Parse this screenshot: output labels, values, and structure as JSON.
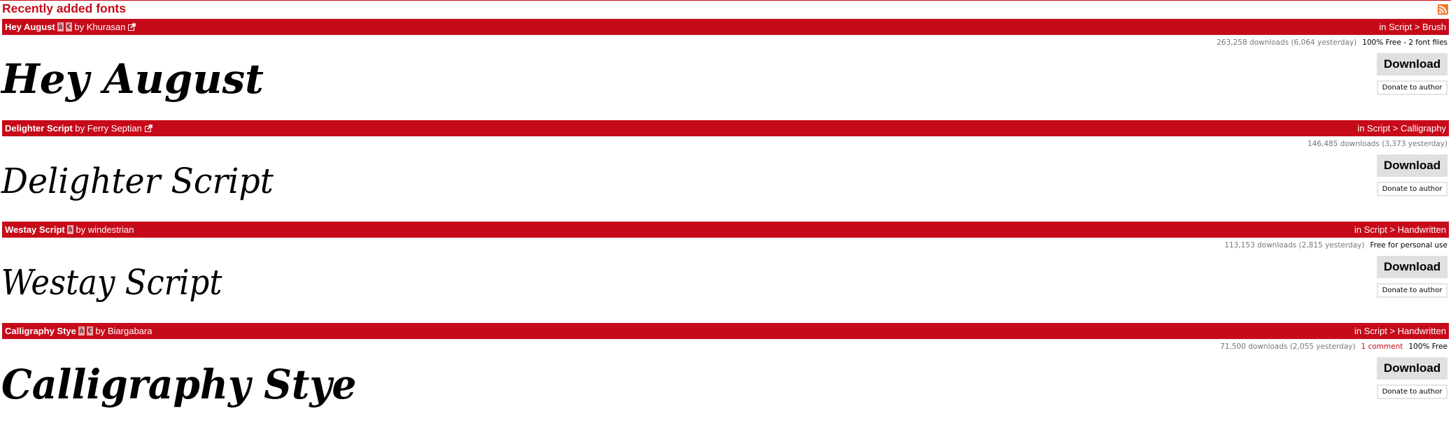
{
  "page": {
    "title": "Recently added fonts",
    "rss_icon": "rss-feed-icon"
  },
  "colors": {
    "accent": "#c70a19",
    "button_bg": "#e0e0e0",
    "muted_text": "#777777",
    "license_badge": "#f3a3a8",
    "rss": "#ee7b2b"
  },
  "fonts": [
    {
      "name": "Hey August",
      "badges": [
        "à",
        "€"
      ],
      "by": "by",
      "author": "Khurasan",
      "external_link_icon": true,
      "category": "in Script > Brush",
      "downloads": "263,258 downloads (6,064 yesterday)",
      "comments": "",
      "license": "100% Free - 2 font files",
      "preview_text": "Hey August",
      "download_label": "Download",
      "donate_label": "Donate to author"
    },
    {
      "name": "Delighter Script",
      "badges": [],
      "by": "by",
      "author": "Ferry Septian",
      "external_link_icon": true,
      "category": "in Script > Calligraphy",
      "downloads": "146,485 downloads (3,373 yesterday)",
      "comments": "",
      "license": "",
      "preview_text": "Delighter Script",
      "download_label": "Download",
      "donate_label": "Donate to author"
    },
    {
      "name": "Westay Script",
      "badges": [
        "à"
      ],
      "by": "by",
      "author": "windestrian",
      "external_link_icon": false,
      "category": "in Script > Handwritten",
      "downloads": "113,153 downloads (2,815 yesterday)",
      "comments": "",
      "license": "Free for personal use",
      "preview_text": "Westay Script",
      "download_label": "Download",
      "donate_label": "Donate to author"
    },
    {
      "name": "Calligraphy Stye",
      "badges": [
        "à",
        "€"
      ],
      "by": "by",
      "author": "Biargabara",
      "external_link_icon": false,
      "category": "in Script > Handwritten",
      "downloads": "71,500 downloads (2,055 yesterday)",
      "comments": "1 comment",
      "license": "100% Free",
      "preview_text": "Calligraphy Stye",
      "download_label": "Download",
      "donate_label": "Donate to author"
    }
  ]
}
